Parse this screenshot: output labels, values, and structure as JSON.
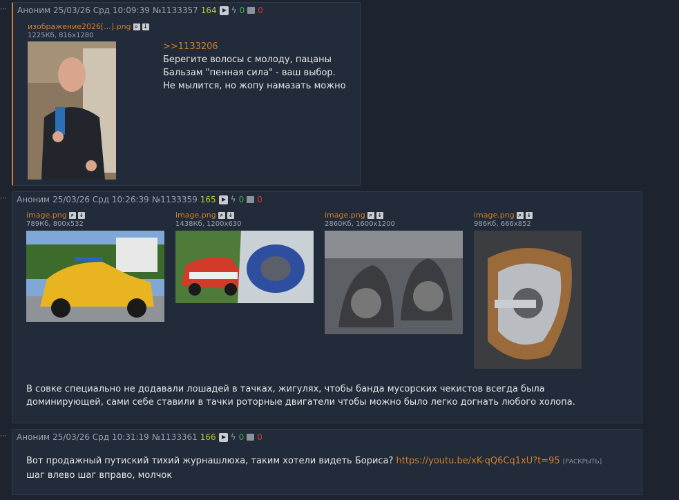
{
  "posts": [
    {
      "author": "Аноним",
      "date": "25/03/26 Срд 10:09:39",
      "number": "№1133357",
      "index": "164",
      "likes": "0",
      "dislikes": "0",
      "files": [
        {
          "name": "изображение2026[...].png",
          "meta": "1225Кб, 816x1280"
        }
      ],
      "reply_to": ">>1133206",
      "lines": [
        "Берегите волосы с молоду, пацаны",
        "Бальзам \"пенная сила\" - ваш выбор.",
        "Не мылится, но жопу намазать можно"
      ]
    },
    {
      "author": "Аноним",
      "date": "25/03/26 Срд 10:26:39",
      "number": "№1133359",
      "index": "165",
      "likes": "0",
      "dislikes": "0",
      "files": [
        {
          "name": "image.png",
          "meta": "789Кб, 800x532"
        },
        {
          "name": "image.png",
          "meta": "1438Кб, 1200x630"
        },
        {
          "name": "image.png",
          "meta": "2860Кб, 1600x1200"
        },
        {
          "name": "image.png",
          "meta": "986Кб, 666x852"
        }
      ],
      "lines": [
        "В совке специально не додавали лошадей в тачках, жигулях, чтобы банда мусорских чекистов всегда была",
        "доминирующей, сами себе ставили в тачки роторные двигатели чтобы можно было легко догнать любого холопа."
      ]
    },
    {
      "author": "Аноним",
      "date": "25/03/26 Срд 10:31:19",
      "number": "№1133361",
      "index": "166",
      "likes": "0",
      "dislikes": "0",
      "text_before_link": "Вот продажный путиский тихий журнашлюха, таким хотели видеть Бориса? ",
      "link": "https://youtu.be/xK-qQ6Cq1xU?t=95",
      "expand": "[РАСКРЫТЬ]",
      "line2": "шаг влево шаг вправо, молчок"
    }
  ]
}
